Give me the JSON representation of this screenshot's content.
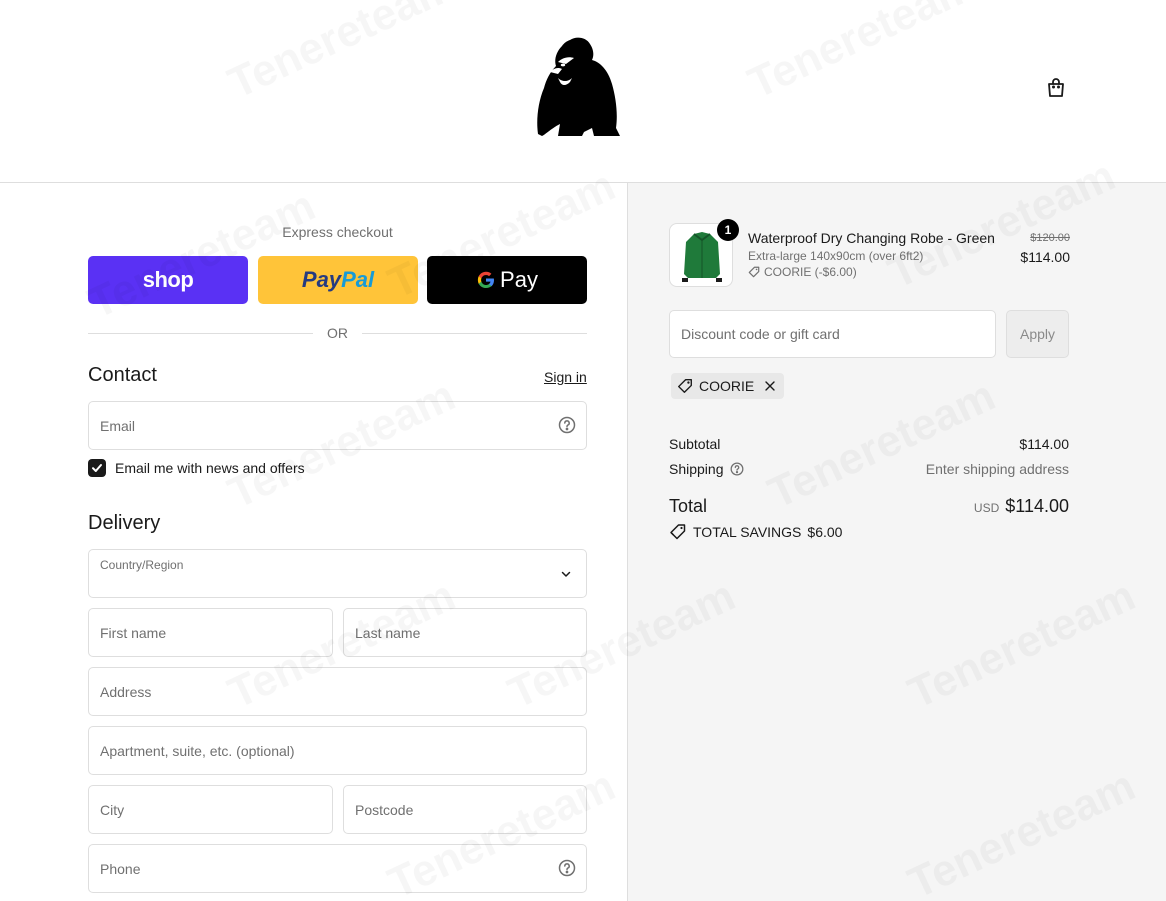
{
  "header": {
    "logo_icon": "gorilla-logo",
    "cart_icon": "shopping-bag-icon"
  },
  "express": {
    "title": "Express checkout",
    "shop_label": "shop",
    "paypal_dark": "Pay",
    "paypal_light": "Pal",
    "gpay_label": "Pay",
    "or_label": "OR"
  },
  "contact": {
    "title": "Contact",
    "sign_in": "Sign in",
    "email_placeholder": "Email",
    "newsletter_label": "Email me with news and offers",
    "newsletter_checked": true
  },
  "delivery": {
    "title": "Delivery",
    "country_label": "Country/Region",
    "first_name": "First name",
    "last_name": "Last name",
    "address": "Address",
    "apartment": "Apartment, suite, etc. (optional)",
    "city": "City",
    "postcode": "Postcode",
    "phone": "Phone"
  },
  "order": {
    "quantity": "1",
    "title": "Waterproof Dry Changing Robe - Green",
    "variant": "Extra-large 140x90cm (over 6ft2)",
    "item_discount": "COORIE (-$6.00)",
    "original_price": "$120.00",
    "price": "$114.00"
  },
  "discount": {
    "placeholder": "Discount code or gift card",
    "apply_label": "Apply",
    "applied_code": "COORIE"
  },
  "totals": {
    "subtotal_label": "Subtotal",
    "subtotal_value": "$114.00",
    "shipping_label": "Shipping",
    "shipping_value": "Enter shipping address",
    "total_label": "Total",
    "currency": "USD",
    "total_value": "$114.00",
    "savings_label": "TOTAL SAVINGS",
    "savings_value": "$6.00"
  },
  "watermark": "Tenereteam",
  "colors": {
    "shop": "#5a31f4",
    "paypal": "#ffc439",
    "gpay": "#000000",
    "summary_bg": "#f5f5f5",
    "product_green": "#1f7a3a"
  }
}
